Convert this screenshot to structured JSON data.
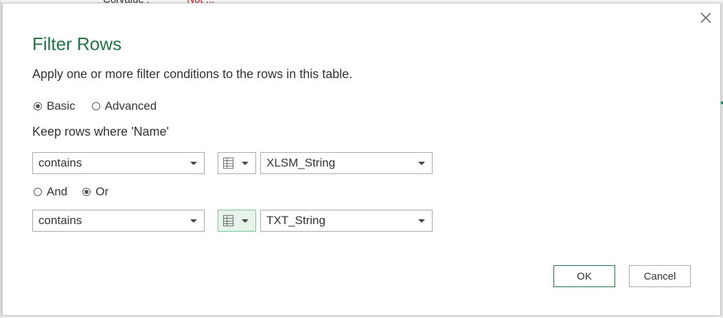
{
  "background_peek": {
    "left_text": "ColValue :",
    "right_text": "Not ..."
  },
  "dialog": {
    "title": "Filter Rows",
    "subtitle": "Apply one or more filter conditions to the rows in this table.",
    "mode": {
      "options": [
        "Basic",
        "Advanced"
      ],
      "selected": "Basic"
    },
    "keep_label": "Keep rows where 'Name'",
    "conditions": [
      {
        "operator": "contains",
        "value_type_icon": "table-list-icon",
        "value": "XLSM_String"
      },
      {
        "operator": "contains",
        "value_type_icon": "table-list-icon",
        "value": "TXT_String"
      }
    ],
    "logic": {
      "options": [
        "And",
        "Or"
      ],
      "selected": "Or"
    },
    "buttons": {
      "ok": "OK",
      "cancel": "Cancel"
    }
  },
  "colors": {
    "title_green": "#217346",
    "ok_border": "#217346",
    "active_type_bg": "#e6f4ea"
  }
}
